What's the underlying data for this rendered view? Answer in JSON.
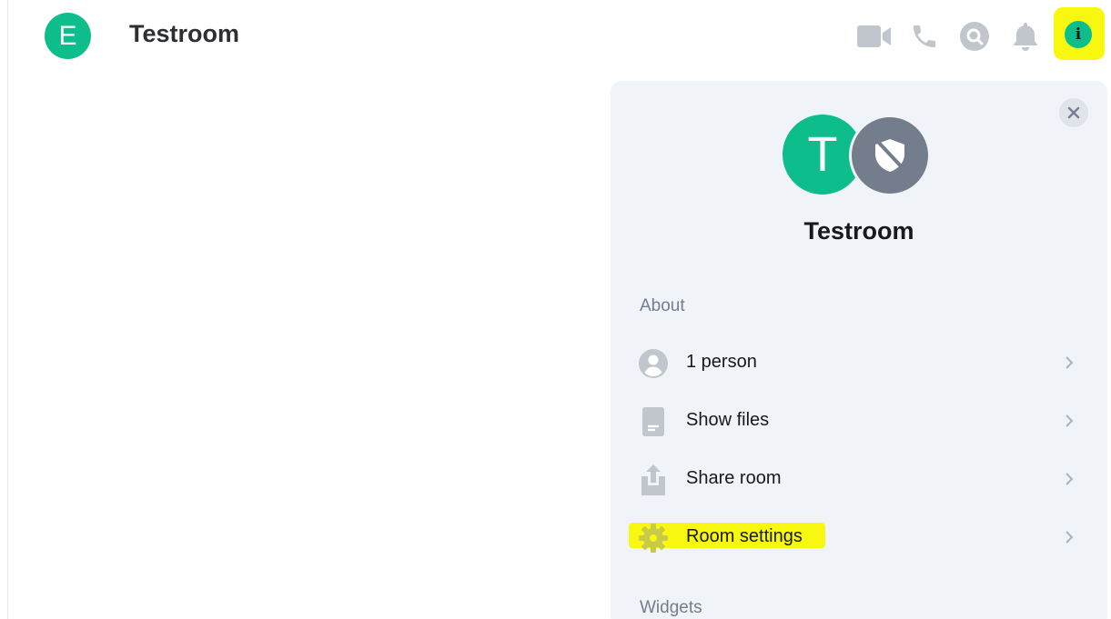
{
  "header": {
    "avatar_letter": "E",
    "room_name": "Testroom",
    "icons": [
      "video-call-icon",
      "voice-call-icon",
      "search-icon",
      "notifications-icon",
      "room-info-icon"
    ],
    "info_glyph": "i"
  },
  "panel": {
    "avatar_letter": "T",
    "title": "Testroom",
    "about_label": "About",
    "widgets_label": "Widgets",
    "items": [
      {
        "label": "1 person",
        "icon": "person-icon"
      },
      {
        "label": "Show files",
        "icon": "file-icon"
      },
      {
        "label": "Share room",
        "icon": "share-icon"
      },
      {
        "label": "Room settings",
        "icon": "gear-icon"
      }
    ]
  },
  "colors": {
    "accent_green": "#0dbd8b",
    "icon_grey": "#c1c6cd",
    "shield_grey": "#737d8c",
    "highlight_yellow": "#f7f70f",
    "panel_bg": "#f0f3f7"
  }
}
